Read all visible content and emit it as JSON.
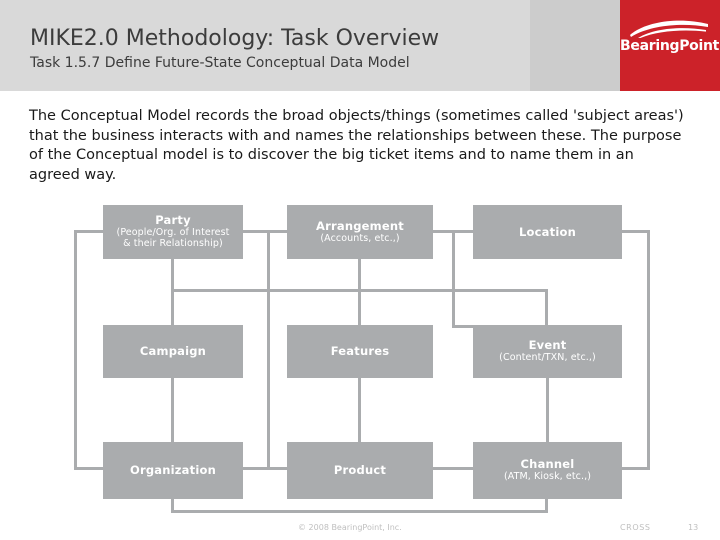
{
  "header": {
    "title": "MIKE2.0 Methodology: Task Overview",
    "subtitle": "Task 1.5.7 Define Future-State Conceptual Data Model",
    "logo_text": "BearingPoint.",
    "logo_icon": "swoosh-arc-icon",
    "band_color": "#d9d9d9",
    "band_mid_color": "#cccccc",
    "logo_color": "#cc2229"
  },
  "body": {
    "paragraph": "The Conceptual Model records the broad objects/things (sometimes called 'subject areas') that the business interacts with and names the relationships between these. The purpose of the Conceptual model is to discover the big ticket items and to name them in an agreed way."
  },
  "diagram": {
    "node_color": "#aaacae",
    "connector_color": "#aaacae",
    "nodes": [
      {
        "id": "party",
        "title": "Party",
        "sub": "(People/Org. of Interest\n& their Relationship)",
        "sub_line1": "(People/Org. of Interest",
        "sub_line2": "& their Relationship)"
      },
      {
        "id": "arrangement",
        "title": "Arrangement",
        "sub_line1": "(Accounts, etc.,)",
        "sub_line2": ""
      },
      {
        "id": "location",
        "title": "Location",
        "sub_line1": "",
        "sub_line2": ""
      },
      {
        "id": "campaign",
        "title": "Campaign",
        "sub_line1": "",
        "sub_line2": ""
      },
      {
        "id": "features",
        "title": "Features",
        "sub_line1": "",
        "sub_line2": ""
      },
      {
        "id": "event",
        "title": "Event",
        "sub_line1": "(Content/TXN, etc.,)",
        "sub_line2": ""
      },
      {
        "id": "organization",
        "title": "Organization",
        "sub_line1": "",
        "sub_line2": ""
      },
      {
        "id": "product",
        "title": "Product",
        "sub_line1": "",
        "sub_line2": ""
      },
      {
        "id": "channel",
        "title": "Channel",
        "sub_line1": "(ATM, Kiosk, etc.,)",
        "sub_line2": ""
      }
    ]
  },
  "footer": {
    "copyright": "© 2008 BearingPoint, Inc.",
    "code": "CROSS",
    "page_number": "13"
  }
}
